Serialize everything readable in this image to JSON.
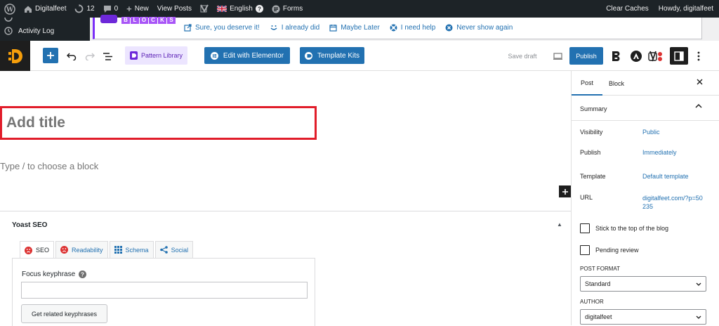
{
  "admin_bar": {
    "site_name": "Digitalfeet",
    "updates_count": "12",
    "comments_count": "0",
    "new_label": "New",
    "view_posts_label": "View Posts",
    "language_label": "English",
    "forms_label": "Forms",
    "clear_caches_label": "Clear Caches",
    "howdy_label": "Howdy, digitalfeet"
  },
  "side_menu": {
    "activity_log_label": "Activity Log"
  },
  "notice": {
    "brand_letters": [
      "B",
      "L",
      "O",
      "C",
      "K",
      "S"
    ],
    "links": [
      {
        "label": "Sure, you deserve it!",
        "icon": "external-link-icon"
      },
      {
        "label": "I already did",
        "icon": "smile-icon"
      },
      {
        "label": "Maybe Later",
        "icon": "calendar-icon"
      },
      {
        "label": "I need help",
        "icon": "lifebuoy-icon"
      },
      {
        "label": "Never show again",
        "icon": "dismiss-icon"
      }
    ]
  },
  "toolbar": {
    "pattern_library_label": "Pattern Library",
    "edit_elementor_label": "Edit with Elementor",
    "template_kits_label": "Template Kits",
    "save_draft_label": "Save draft",
    "publish_label": "Publish"
  },
  "editor": {
    "title_placeholder": "Add title",
    "block_placeholder": "Type / to choose a block"
  },
  "yoast": {
    "title": "Yoast SEO",
    "tabs": [
      "SEO",
      "Readability",
      "Schema",
      "Social"
    ],
    "focus_keyphrase_label": "Focus keyphrase",
    "related_button_label": "Get related keyphrases"
  },
  "sidebar": {
    "tab_post": "Post",
    "tab_block": "Block",
    "summary_label": "Summary",
    "rows": [
      {
        "label": "Visibility",
        "value": "Public"
      },
      {
        "label": "Publish",
        "value": "Immediately"
      },
      {
        "label": "Template",
        "value": "Default template"
      },
      {
        "label": "URL",
        "value": "digitalfeet.com/?p=50235"
      }
    ],
    "stick_label": "Stick to the top of the blog",
    "pending_label": "Pending review",
    "post_format_label": "POST FORMAT",
    "post_format_value": "Standard",
    "author_label": "AUTHOR",
    "author_value": "digitalfeet"
  },
  "colors": {
    "accent": "#2271b1",
    "title_outline": "#e11d2a",
    "admin_bar": "#1d2327"
  }
}
